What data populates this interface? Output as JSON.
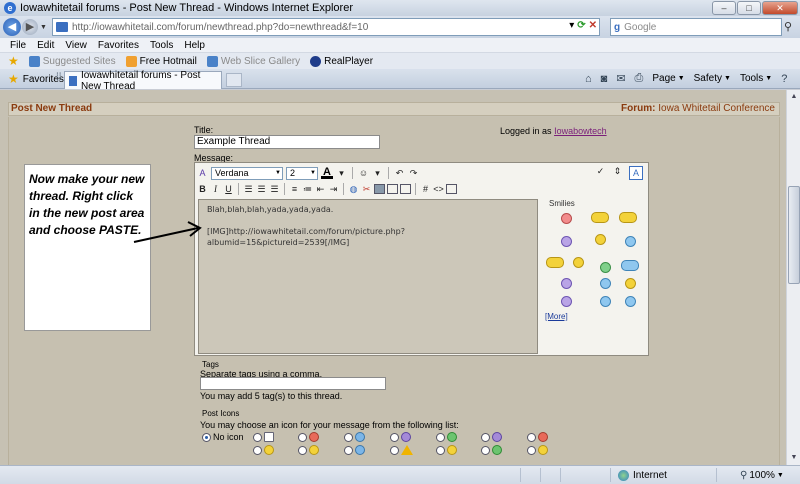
{
  "window": {
    "title": "Iowawhitetail forums - Post New Thread - Windows Internet Explorer",
    "minimize": "–",
    "maximize": "□",
    "close": "✕"
  },
  "address": {
    "url": "http://iowawhitetail.com/forum/newthread.php?do=newthread&f=10",
    "search_placeholder": "Google"
  },
  "menu": [
    "File",
    "Edit",
    "View",
    "Favorites",
    "Tools",
    "Help"
  ],
  "favorites_bar": {
    "items": [
      {
        "label": "Suggested Sites",
        "disabled": true
      },
      {
        "label": "Free Hotmail",
        "disabled": false
      },
      {
        "label": "Web Slice Gallery",
        "disabled": true
      },
      {
        "label": "RealPlayer",
        "disabled": false
      }
    ]
  },
  "tabs": {
    "favorites_label": "Favorites",
    "active_tab": "Iowawhitetail forums - Post New Thread"
  },
  "command_bar": {
    "page": "Page",
    "safety": "Safety",
    "tools": "Tools"
  },
  "forum": {
    "header_title": "Post New Thread",
    "forum_prefix": "Forum:",
    "forum_name": "Iowa Whitetail Conference",
    "title_label": "Title:",
    "title_value": "Example Thread",
    "logged_in_prefix": "Logged in as",
    "logged_in_user": "Iowabowtech",
    "message_label": "Message:"
  },
  "editor": {
    "font": "Verdana",
    "size": "2",
    "color_glyph": "A",
    "line1": "Blah,blah,blah,yada,yada,yada.",
    "line2": "[IMG]http://iowawhitetail.com/forum/picture.php?",
    "line3": "albumid=15&pictureid=2539[/IMG]",
    "smilies_title": "Smilies",
    "more_label": "[More]",
    "bold": "B",
    "italic": "I",
    "underline": "U",
    "hash": "#",
    "code": "<>"
  },
  "tags": {
    "label": "Tags",
    "hint": "Separate tags using a comma.",
    "note": "You may add 5 tag(s) to this thread."
  },
  "post_icons": {
    "label": "Post Icons",
    "hint": "You may choose an icon for your message from the following list:",
    "no_icon": "No icon"
  },
  "annotation": {
    "text": "Now make your new thread. Right click in the new post area and choose PASTE."
  },
  "status": {
    "zone": "Internet",
    "zoom": "100%"
  }
}
